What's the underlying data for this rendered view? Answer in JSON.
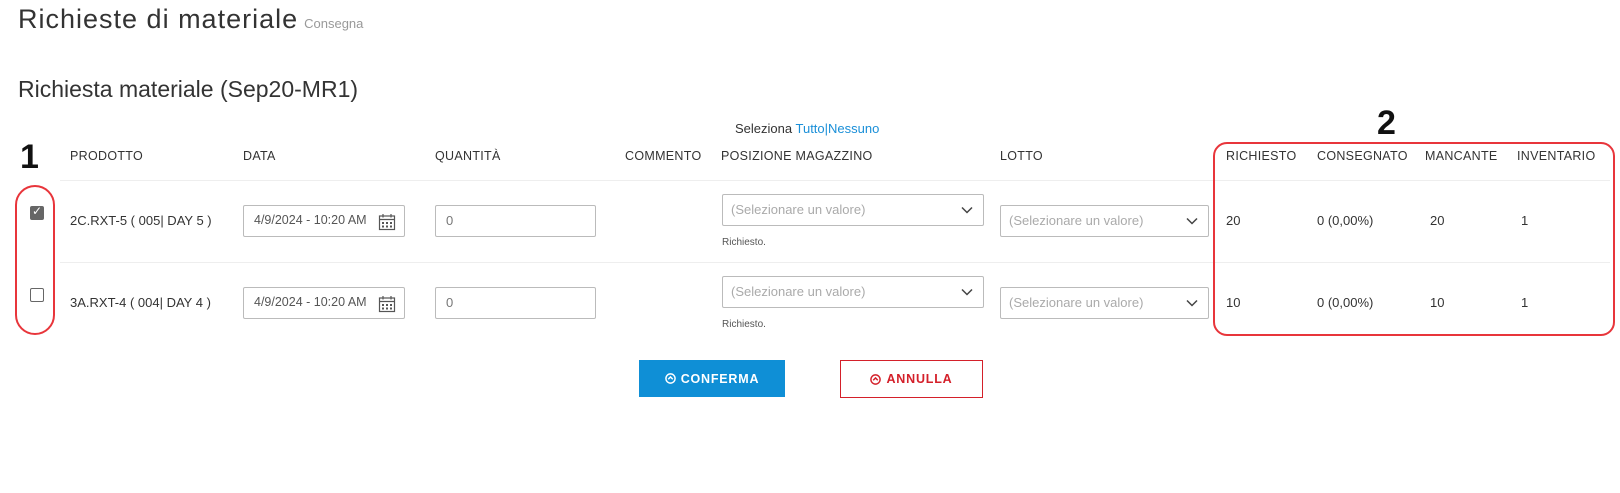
{
  "page": {
    "title": "Richieste di materiale",
    "subtitle": "Consegna"
  },
  "section": {
    "title": "Richiesta materiale (Sep20-MR1)"
  },
  "select": {
    "label": "Seleziona",
    "all": "Tutto",
    "separator": "|",
    "none": "Nessuno"
  },
  "columns": {
    "product": "PRODOTTO",
    "date": "DATA",
    "quantity": "QUANTITÀ",
    "comment": "COMMENTO",
    "location": "POSIZIONE MAGAZZINO",
    "lot": "LOTTO",
    "requested": "RICHIESTO",
    "delivered": "CONSEGNATO",
    "missing": "MANCANTE",
    "inventory": "INVENTARIO"
  },
  "rows": [
    {
      "checked": true,
      "product": "2C.RXT-5 ( 005| DAY 5 )",
      "date": "4/9/2024 - 10:20 AM",
      "quantity": "0",
      "location_placeholder": "(Selezionare un valore)",
      "location_hint": "Richiesto.",
      "lot_placeholder": "(Selezionare un valore)",
      "requested": "20",
      "delivered": "0 (0,00%)",
      "missing": "20",
      "inventory": "1"
    },
    {
      "checked": false,
      "product": "3A.RXT-4 ( 004| DAY 4 )",
      "date": "4/9/2024 - 10:20 AM",
      "quantity": "0",
      "location_placeholder": "(Selezionare un valore)",
      "location_hint": "Richiesto.",
      "lot_placeholder": "(Selezionare un valore)",
      "requested": "10",
      "delivered": "0 (0,00%)",
      "missing": "10",
      "inventory": "1"
    }
  ],
  "buttons": {
    "confirm": "CONFERMA",
    "cancel": "ANNULLA"
  },
  "callouts": {
    "one": "1",
    "two": "2"
  },
  "colors": {
    "accent": "#0f8fd6",
    "danger": "#d4202a",
    "callout": "#e8353b"
  }
}
